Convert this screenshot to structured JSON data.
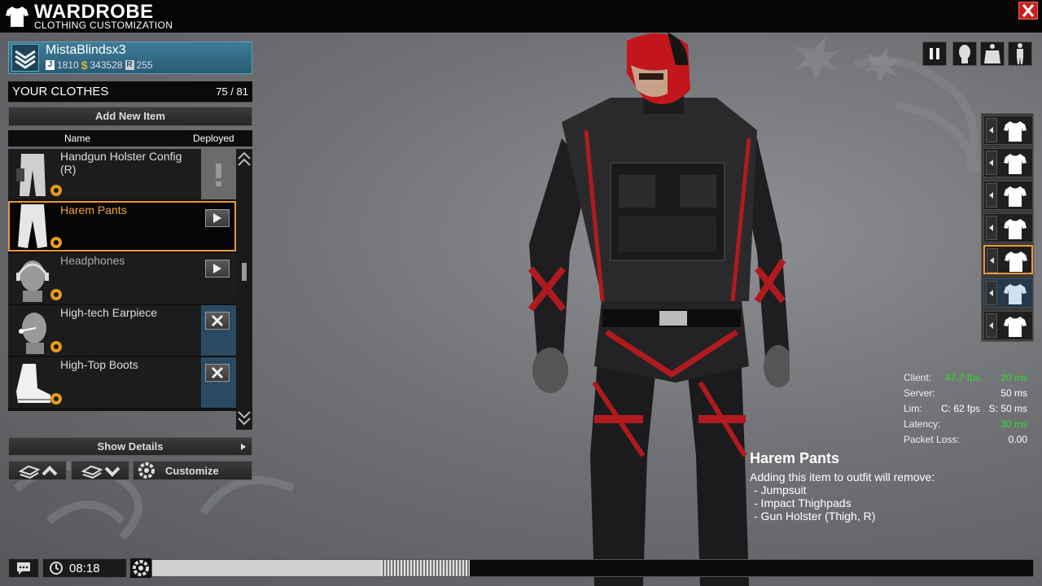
{
  "window": {
    "title": "WARDROBE",
    "subtitle": "CLOTHING CUSTOMIZATION",
    "close_icon": "close-icon"
  },
  "profile": {
    "username": "MistaBlindsx3",
    "joules": "1810",
    "cash": "343528",
    "rating": "255",
    "joule_badge": "J",
    "rating_badge": "R",
    "cash_symbol": "$"
  },
  "clothes": {
    "header": "YOUR CLOTHES",
    "count": "75 / 81",
    "add_button": "Add New Item",
    "col_name": "Name",
    "col_deployed": "Deployed",
    "items": [
      {
        "name": "Handgun Holster Config (R)",
        "state": "warning"
      },
      {
        "name": "Harem Pants",
        "state": "arrow"
      },
      {
        "name": "Headphones",
        "state": "arrow"
      },
      {
        "name": "High-tech Earpiece",
        "state": "remove"
      },
      {
        "name": "High-Top Boots",
        "state": "remove"
      }
    ],
    "show_details": "Show Details",
    "customize": "Customize"
  },
  "net": {
    "client_label": "Client:",
    "client_fps": "47.7 fps",
    "client_ms": "20 ms",
    "server_label": "Server:",
    "server_ms": "50 ms",
    "lim_label": "Lim:",
    "lim_c": "C: 62 fps",
    "lim_s": "S: 50 ms",
    "latency_label": "Latency:",
    "latency_ms": "30 ms",
    "packet_label": "Packet Loss:",
    "packet_val": "0.00",
    "good_color": "#2ee02e"
  },
  "info": {
    "title": "Harem Pants",
    "text": "Adding this item to outfit will remove:",
    "removes": [
      "- Jumpsuit",
      "- Impact Thighpads",
      "- Gun Holster (Thigh, R)"
    ]
  },
  "bottom": {
    "time": "08:18",
    "progress_fill": 0.36
  },
  "colors": {
    "accent": "#e8983a",
    "profile": "#2a5c74",
    "close": "#c8201e"
  }
}
